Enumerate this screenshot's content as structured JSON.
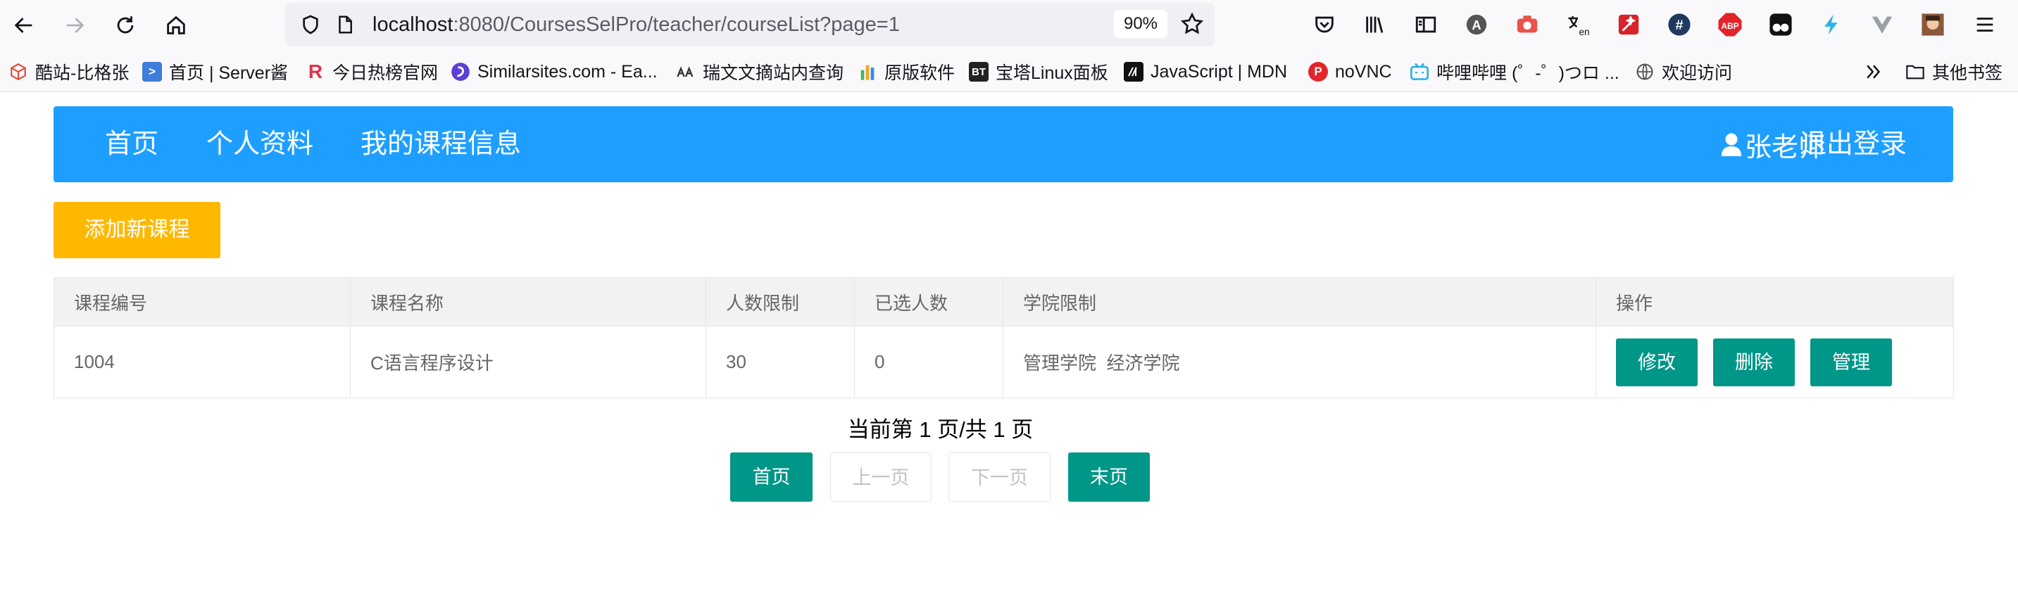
{
  "browser": {
    "url_host": "localhost",
    "url_rest": ":8080/CoursesSelPro/teacher/courseList?page=1",
    "zoom": "90%",
    "bookmarks": [
      {
        "label": "酷站-比格张",
        "icon": "cube-icon",
        "color": "#e04b3a"
      },
      {
        "label": "首页 | Server酱",
        "icon": "chevron-right-icon",
        "color": "#3d7ddb"
      },
      {
        "label": "今日热榜官网",
        "icon": "R",
        "color": "#e0334a"
      },
      {
        "label": "Similarsites.com - Ea...",
        "icon": "similarsites-icon",
        "color": "#5b3fd6"
      },
      {
        "label": "瑞文文摘站内查询",
        "icon": "ruiwen-icon",
        "color": "#333333"
      },
      {
        "label": "原版软件",
        "icon": "bars-icon",
        "color": "#f5a623"
      },
      {
        "label": "宝塔Linux面板",
        "icon": "BT",
        "color": "#222222"
      },
      {
        "label": "JavaScript | MDN",
        "icon": "mdn-icon",
        "color": "#111111"
      },
      {
        "label": "noVNC",
        "icon": "P",
        "color": "#e3242b"
      },
      {
        "label": "哔哩哔哩 (゜-゜)つロ ...",
        "icon": "bilibili-icon",
        "color": "#23ade5"
      },
      {
        "label": "欢迎访问",
        "icon": "globe-icon",
        "color": "#555555"
      }
    ],
    "other_bookmarks": "其他书签"
  },
  "nav": {
    "home": "首页",
    "profile": "个人资料",
    "my_courses": "我的课程信息",
    "user": "张老师",
    "logout": "退出登录",
    "color": "#1e9fff"
  },
  "add_button": "添加新课程",
  "table": {
    "headers": [
      "课程编号",
      "课程名称",
      "人数限制",
      "已选人数",
      "学院限制",
      "操作"
    ],
    "rows": [
      {
        "id": "1004",
        "name": "C语言程序设计",
        "limit": "30",
        "selected": "0",
        "college": "管理学院  经济学院",
        "edit": "修改",
        "delete": "删除",
        "manage": "管理"
      }
    ]
  },
  "pagination": {
    "info": "当前第 1 页/共 1 页",
    "first": "首页",
    "prev": "上一页",
    "next": "下一页",
    "last": "末页"
  }
}
